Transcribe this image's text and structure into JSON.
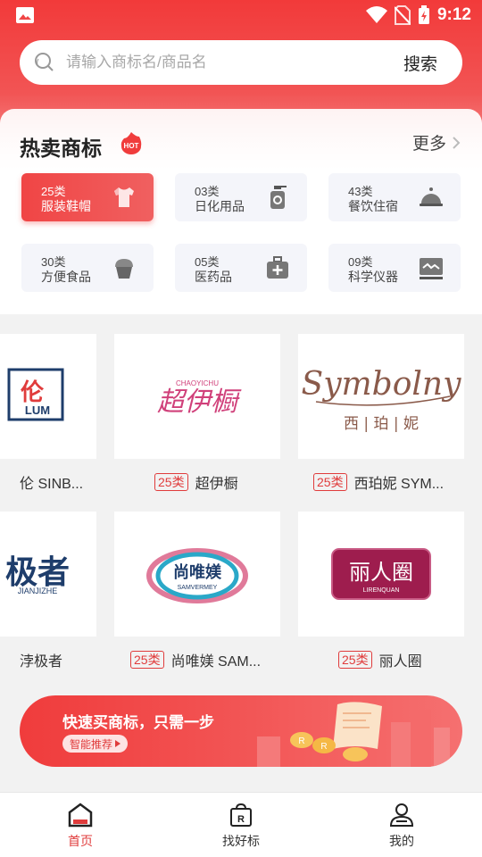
{
  "status": {
    "time": "9:12"
  },
  "search": {
    "placeholder": "请输入商标名/商品名",
    "button": "搜索"
  },
  "hot": {
    "title": "热卖商标",
    "badge": "HOT",
    "more": "更多",
    "categories": [
      {
        "code": "25类",
        "name": "服装鞋帽",
        "icon": "tshirt-icon"
      },
      {
        "code": "03类",
        "name": "日化用品",
        "icon": "spray-bottle-icon"
      },
      {
        "code": "43类",
        "name": "餐饮住宿",
        "icon": "cloche-icon"
      },
      {
        "code": "30类",
        "name": "方便食品",
        "icon": "cupcake-icon"
      },
      {
        "code": "05类",
        "name": "医药品",
        "icon": "medical-kit-icon"
      },
      {
        "code": "09类",
        "name": "科学仪器",
        "icon": "monitor-icon"
      }
    ]
  },
  "trademarks": [
    {
      "tag": "",
      "name": "伦 SINB...",
      "logo_text": "伦",
      "logo_sub": "LUM"
    },
    {
      "tag": "25类",
      "name": "超伊橱",
      "logo_text": "超伊橱",
      "logo_sub": "CHAOYICHU"
    },
    {
      "tag": "25类",
      "name": "西珀妮 SYM...",
      "logo_text": "Symbolny",
      "logo_sub": "西 | 珀 | 妮"
    },
    {
      "tag": "",
      "name": "浡极者",
      "logo_text": "极者",
      "logo_sub": "JIANJIZHE"
    },
    {
      "tag": "25类",
      "name": "尚唯媄 SAM...",
      "logo_text": "尚唯媄",
      "logo_sub": "SAMVERMEY"
    },
    {
      "tag": "25类",
      "name": "丽人圈",
      "logo_text": "丽人圈",
      "logo_sub": "LIRENQUAN"
    }
  ],
  "banner": {
    "headline": "快速买商标，只需一步",
    "cta": "智能推荐"
  },
  "nav": [
    {
      "label": "首页",
      "icon": "home-icon"
    },
    {
      "label": "找好标",
      "icon": "trademark-bag-icon"
    },
    {
      "label": "我的",
      "icon": "user-icon"
    }
  ],
  "colors": {
    "primary": "#f03c3c",
    "tag": "#e03c3c",
    "pink": "#d0407a",
    "brown": "#8a5a4a",
    "navy": "#1e3d6b",
    "maroon": "#9e1d4e"
  }
}
